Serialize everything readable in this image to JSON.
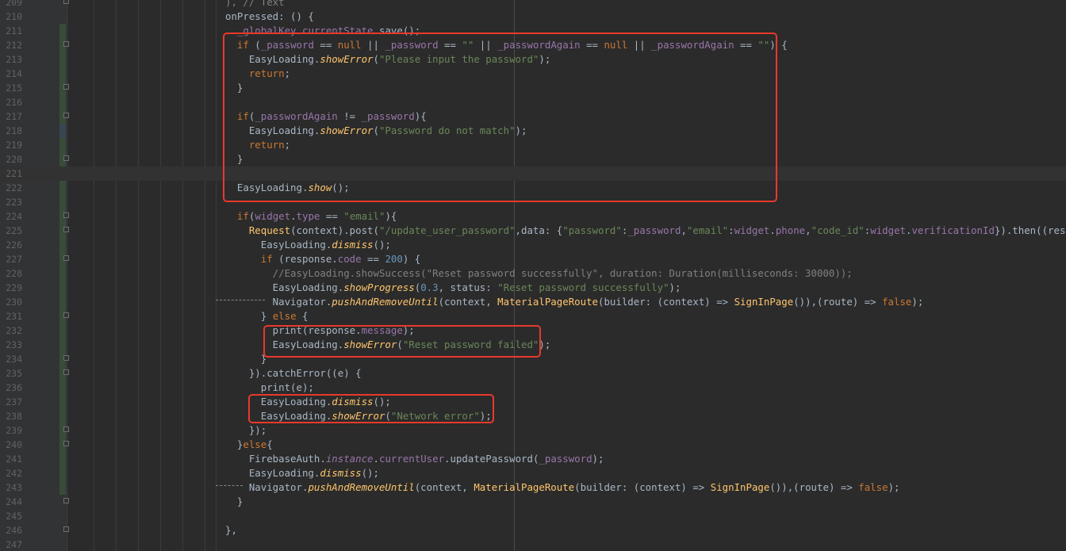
{
  "editor": {
    "lines": [
      {
        "n": "209",
        "segs": [
          {
            "t": "), // Text",
            "c": "cmt"
          }
        ]
      },
      {
        "n": "210",
        "segs": [
          {
            "t": "onPressed: () {",
            "c": ""
          }
        ]
      },
      {
        "n": "211",
        "segs": [
          {
            "t": "  ",
            "c": ""
          },
          {
            "t": "_globalKey",
            "c": "fld"
          },
          {
            "t": ".",
            "c": ""
          },
          {
            "t": "currentState",
            "c": "fld"
          },
          {
            "t": ".save();",
            "c": ""
          }
        ]
      },
      {
        "n": "212",
        "segs": [
          {
            "t": "  ",
            "c": ""
          },
          {
            "t": "if",
            "c": "kw"
          },
          {
            "t": " (",
            "c": ""
          },
          {
            "t": "_password",
            "c": "fld"
          },
          {
            "t": " == ",
            "c": ""
          },
          {
            "t": "null",
            "c": "kw"
          },
          {
            "t": " || ",
            "c": ""
          },
          {
            "t": "_password",
            "c": "fld"
          },
          {
            "t": " == ",
            "c": ""
          },
          {
            "t": "\"\"",
            "c": "str"
          },
          {
            "t": " || ",
            "c": ""
          },
          {
            "t": "_passwordAgain",
            "c": "fld"
          },
          {
            "t": " == ",
            "c": ""
          },
          {
            "t": "null",
            "c": "kw"
          },
          {
            "t": " || ",
            "c": ""
          },
          {
            "t": "_passwordAgain",
            "c": "fld"
          },
          {
            "t": " == ",
            "c": ""
          },
          {
            "t": "\"\"",
            "c": "str"
          },
          {
            "t": ") {",
            "c": ""
          }
        ]
      },
      {
        "n": "213",
        "segs": [
          {
            "t": "    EasyLoading.",
            "c": ""
          },
          {
            "t": "showError",
            "c": "mth ital"
          },
          {
            "t": "(",
            "c": ""
          },
          {
            "t": "\"Please input the password\"",
            "c": "str"
          },
          {
            "t": ");",
            "c": ""
          }
        ]
      },
      {
        "n": "214",
        "segs": [
          {
            "t": "    ",
            "c": ""
          },
          {
            "t": "return",
            "c": "kw"
          },
          {
            "t": ";",
            "c": ""
          }
        ]
      },
      {
        "n": "215",
        "segs": [
          {
            "t": "  }",
            "c": ""
          }
        ]
      },
      {
        "n": "216",
        "segs": []
      },
      {
        "n": "217",
        "segs": [
          {
            "t": "  ",
            "c": ""
          },
          {
            "t": "if",
            "c": "kw"
          },
          {
            "t": "(",
            "c": ""
          },
          {
            "t": "_passwordAgain",
            "c": "fld"
          },
          {
            "t": " != ",
            "c": ""
          },
          {
            "t": "_password",
            "c": "fld"
          },
          {
            "t": "){",
            "c": ""
          }
        ]
      },
      {
        "n": "218",
        "segs": [
          {
            "t": "    EasyLoading.",
            "c": ""
          },
          {
            "t": "showError",
            "c": "mth ital"
          },
          {
            "t": "(",
            "c": ""
          },
          {
            "t": "\"Password do not match\"",
            "c": "str"
          },
          {
            "t": ");",
            "c": ""
          }
        ]
      },
      {
        "n": "219",
        "segs": [
          {
            "t": "    ",
            "c": ""
          },
          {
            "t": "return",
            "c": "kw"
          },
          {
            "t": ";",
            "c": ""
          }
        ]
      },
      {
        "n": "220",
        "segs": [
          {
            "t": "  }",
            "c": ""
          }
        ]
      },
      {
        "n": "221",
        "segs": []
      },
      {
        "n": "222",
        "segs": [
          {
            "t": "  EasyLoading.",
            "c": ""
          },
          {
            "t": "show",
            "c": "mth ital"
          },
          {
            "t": "();",
            "c": ""
          }
        ]
      },
      {
        "n": "223",
        "segs": []
      },
      {
        "n": "224",
        "segs": [
          {
            "t": "  ",
            "c": ""
          },
          {
            "t": "if",
            "c": "kw"
          },
          {
            "t": "(",
            "c": ""
          },
          {
            "t": "widget",
            "c": "fld"
          },
          {
            "t": ".",
            "c": ""
          },
          {
            "t": "type",
            "c": "fld"
          },
          {
            "t": " == ",
            "c": ""
          },
          {
            "t": "\"email\"",
            "c": "str"
          },
          {
            "t": "){",
            "c": ""
          }
        ]
      },
      {
        "n": "225",
        "segs": [
          {
            "t": "    ",
            "c": ""
          },
          {
            "t": "Request",
            "c": "mth"
          },
          {
            "t": "(context).post(",
            "c": ""
          },
          {
            "t": "\"/update_user_password\"",
            "c": "str"
          },
          {
            "t": ",data: {",
            "c": ""
          },
          {
            "t": "\"password\"",
            "c": "str"
          },
          {
            "t": ":",
            "c": ""
          },
          {
            "t": "_password",
            "c": "fld"
          },
          {
            "t": ",",
            "c": ""
          },
          {
            "t": "\"email\"",
            "c": "str"
          },
          {
            "t": ":",
            "c": ""
          },
          {
            "t": "widget",
            "c": "fld"
          },
          {
            "t": ".",
            "c": ""
          },
          {
            "t": "phone",
            "c": "fld"
          },
          {
            "t": ",",
            "c": ""
          },
          {
            "t": "\"code_id\"",
            "c": "str"
          },
          {
            "t": ":",
            "c": ""
          },
          {
            "t": "widget",
            "c": "fld"
          },
          {
            "t": ".",
            "c": ""
          },
          {
            "t": "verificationId",
            "c": "fld"
          },
          {
            "t": "}).then((response) {",
            "c": ""
          }
        ]
      },
      {
        "n": "226",
        "segs": [
          {
            "t": "      EasyLoading.",
            "c": ""
          },
          {
            "t": "dismiss",
            "c": "mth ital"
          },
          {
            "t": "();",
            "c": ""
          }
        ]
      },
      {
        "n": "227",
        "segs": [
          {
            "t": "      ",
            "c": ""
          },
          {
            "t": "if",
            "c": "kw"
          },
          {
            "t": " (response.",
            "c": ""
          },
          {
            "t": "code",
            "c": "fld"
          },
          {
            "t": " == ",
            "c": ""
          },
          {
            "t": "200",
            "c": "num"
          },
          {
            "t": ") {",
            "c": ""
          }
        ]
      },
      {
        "n": "228",
        "segs": [
          {
            "t": "        //EasyLoading.showSuccess(\"Reset password successfully\", duration: Duration(milliseconds: 30000));",
            "c": "cmt"
          }
        ]
      },
      {
        "n": "229",
        "segs": [
          {
            "t": "        EasyLoading.",
            "c": ""
          },
          {
            "t": "showProgress",
            "c": "mth ital"
          },
          {
            "t": "(",
            "c": ""
          },
          {
            "t": "0.3",
            "c": "num"
          },
          {
            "t": ", status: ",
            "c": ""
          },
          {
            "t": "\"Reset password successfully\"",
            "c": "str"
          },
          {
            "t": ");",
            "c": ""
          }
        ]
      },
      {
        "n": "230",
        "segs": [
          {
            "t": "        Navigator.",
            "c": ""
          },
          {
            "t": "pushAndRemoveUntil",
            "c": "mth ital"
          },
          {
            "t": "(context, ",
            "c": ""
          },
          {
            "t": "MaterialPageRoute",
            "c": "mth"
          },
          {
            "t": "(builder: (context) => ",
            "c": ""
          },
          {
            "t": "SignInPage",
            "c": "mth"
          },
          {
            "t": "()),(route) => ",
            "c": ""
          },
          {
            "t": "false",
            "c": "kw"
          },
          {
            "t": ");",
            "c": ""
          }
        ]
      },
      {
        "n": "231",
        "segs": [
          {
            "t": "      } ",
            "c": ""
          },
          {
            "t": "else",
            "c": "kw"
          },
          {
            "t": " {",
            "c": ""
          }
        ]
      },
      {
        "n": "232",
        "segs": [
          {
            "t": "        print(response.",
            "c": ""
          },
          {
            "t": "message",
            "c": "fld"
          },
          {
            "t": ");",
            "c": ""
          }
        ]
      },
      {
        "n": "233",
        "segs": [
          {
            "t": "        EasyLoading.",
            "c": ""
          },
          {
            "t": "showError",
            "c": "mth ital"
          },
          {
            "t": "(",
            "c": ""
          },
          {
            "t": "\"Reset password failed\"",
            "c": "str"
          },
          {
            "t": ");",
            "c": ""
          }
        ]
      },
      {
        "n": "234",
        "segs": [
          {
            "t": "      }",
            "c": ""
          }
        ]
      },
      {
        "n": "235",
        "segs": [
          {
            "t": "    }).catchError((e) {",
            "c": ""
          }
        ]
      },
      {
        "n": "236",
        "segs": [
          {
            "t": "      print(e);",
            "c": ""
          }
        ]
      },
      {
        "n": "237",
        "segs": [
          {
            "t": "      EasyLoading.",
            "c": ""
          },
          {
            "t": "dismiss",
            "c": "mth ital"
          },
          {
            "t": "();",
            "c": ""
          }
        ]
      },
      {
        "n": "238",
        "segs": [
          {
            "t": "      EasyLoading.",
            "c": ""
          },
          {
            "t": "showError",
            "c": "mth ital"
          },
          {
            "t": "(",
            "c": ""
          },
          {
            "t": "\"Network error\"",
            "c": "str"
          },
          {
            "t": ");",
            "c": ""
          }
        ]
      },
      {
        "n": "239",
        "segs": [
          {
            "t": "    });",
            "c": ""
          }
        ]
      },
      {
        "n": "240",
        "segs": [
          {
            "t": "  }",
            "c": ""
          },
          {
            "t": "else",
            "c": "kw"
          },
          {
            "t": "{",
            "c": ""
          }
        ]
      },
      {
        "n": "241",
        "segs": [
          {
            "t": "    FirebaseAuth.",
            "c": ""
          },
          {
            "t": "instance",
            "c": "fld ital"
          },
          {
            "t": ".",
            "c": ""
          },
          {
            "t": "currentUser",
            "c": "fld"
          },
          {
            "t": ".updatePassword(",
            "c": ""
          },
          {
            "t": "_password",
            "c": "fld"
          },
          {
            "t": ");",
            "c": ""
          }
        ]
      },
      {
        "n": "242",
        "segs": [
          {
            "t": "    EasyLoading.",
            "c": ""
          },
          {
            "t": "dismiss",
            "c": "mth ital"
          },
          {
            "t": "();",
            "c": ""
          }
        ]
      },
      {
        "n": "243",
        "segs": [
          {
            "t": "    Navigator.",
            "c": ""
          },
          {
            "t": "pushAndRemoveUntil",
            "c": "mth ital"
          },
          {
            "t": "(context, ",
            "c": ""
          },
          {
            "t": "MaterialPageRoute",
            "c": "mth"
          },
          {
            "t": "(builder: (context) => ",
            "c": ""
          },
          {
            "t": "SignInPage",
            "c": "mth"
          },
          {
            "t": "()),(route) => ",
            "c": ""
          },
          {
            "t": "false",
            "c": "kw"
          },
          {
            "t": ");",
            "c": ""
          }
        ]
      },
      {
        "n": "244",
        "segs": [
          {
            "t": "  }",
            "c": ""
          }
        ]
      },
      {
        "n": "245",
        "segs": []
      },
      {
        "n": "246",
        "segs": [
          {
            "t": "},",
            "c": ""
          }
        ]
      },
      {
        "n": "247",
        "segs": []
      }
    ],
    "current_line": "221",
    "highlight_color": "#e8392c"
  }
}
